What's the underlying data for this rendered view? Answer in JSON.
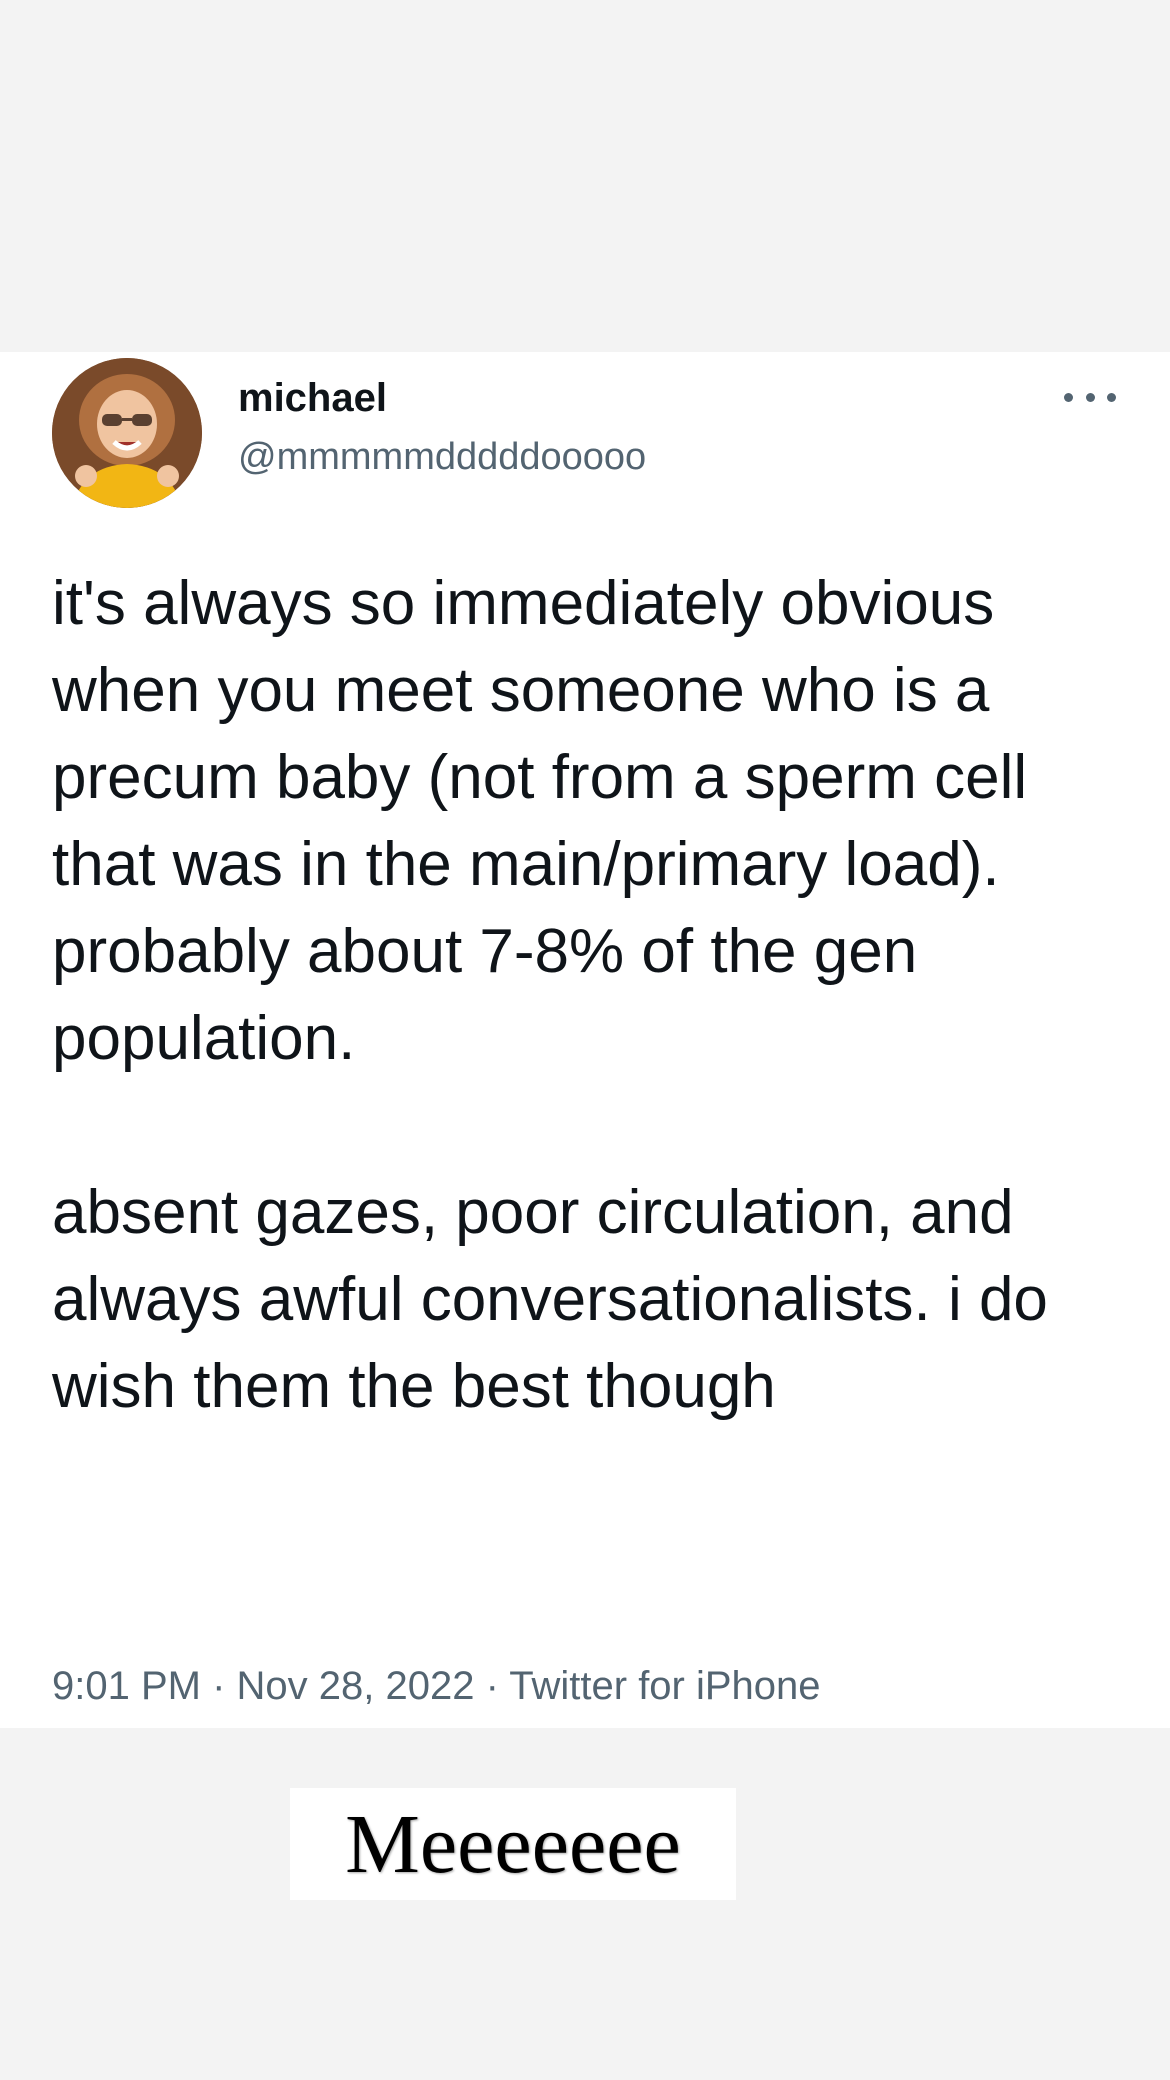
{
  "tweet": {
    "author": {
      "display_name": "michael",
      "handle": "@mmmmmdddddooooo",
      "avatar_icon": "avatar-photo-icon"
    },
    "more_icon": "more-options-icon",
    "paragraphs": [
      "it's always so immediately obvious when you meet someone who is a precum baby (not from a sperm cell that was in the main/primary load). probably about 7-8% of the gen population.",
      "absent gazes, poor circulation, and always awful conversationalists. i do wish them the best though"
    ],
    "meta": "9:01 PM · Nov 28, 2022 · Twitter for iPhone"
  },
  "caption": {
    "text": "Meeeeeee"
  },
  "colors": {
    "background": "#f3f3f3",
    "card": "#ffffff",
    "text": "#0f1419",
    "secondary_text": "#536471"
  }
}
